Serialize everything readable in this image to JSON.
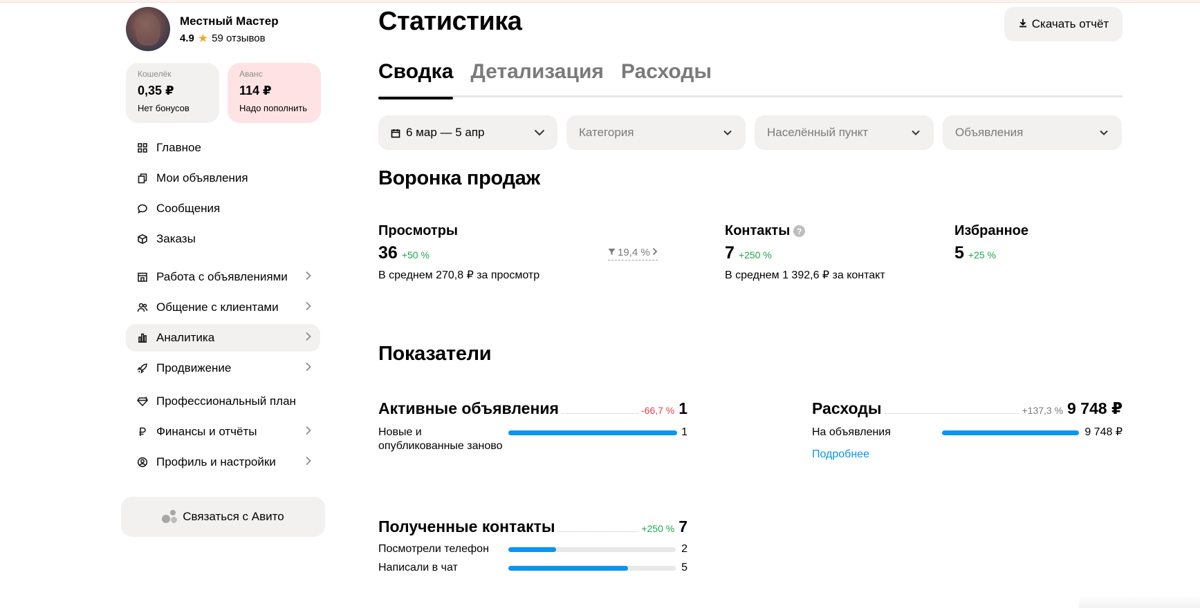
{
  "profile": {
    "name": "Местный Мастер",
    "rating": "4.9",
    "reviews": "59 отзывов"
  },
  "wallet": {
    "label": "Кошелёк",
    "value": "0,35 ₽",
    "sub": "Нет бонусов"
  },
  "advance": {
    "label": "Аванс",
    "value": "114 ₽",
    "sub": "Надо пополнить"
  },
  "nav": {
    "items": [
      {
        "label": "Главное",
        "icon": "grid-icon"
      },
      {
        "label": "Мои объявления",
        "icon": "copy-icon"
      },
      {
        "label": "Сообщения",
        "icon": "chat-bubble-icon"
      },
      {
        "label": "Заказы",
        "icon": "box-icon"
      },
      {
        "label": "Работа с объявлениями",
        "icon": "store-icon"
      },
      {
        "label": "Общение с клиентами",
        "icon": "people-icon"
      },
      {
        "label": "Аналитика",
        "icon": "bar-chart-icon",
        "active": true
      },
      {
        "label": "Продвижение",
        "icon": "rocket-icon"
      },
      {
        "label": "Профессиональный план",
        "icon": "diamond-icon"
      },
      {
        "label": "Финансы и отчёты",
        "icon": "ruble-icon"
      },
      {
        "label": "Профиль и настройки",
        "icon": "user-circle-icon"
      }
    ],
    "contact_button": "Связаться с Авито"
  },
  "header": {
    "title": "Статистика",
    "download_label": "Скачать отчёт"
  },
  "tabs": [
    {
      "label": "Сводка",
      "active": true
    },
    {
      "label": "Детализация"
    },
    {
      "label": "Расходы"
    }
  ],
  "filters": {
    "date": "6 мар — 5 апр",
    "category": "Категория",
    "location": "Населённый пункт",
    "ads": "Объявления"
  },
  "funnel": {
    "title": "Воронка продаж",
    "views": {
      "title": "Просмотры",
      "value": "36",
      "delta": "+50 %",
      "sub": "В среднем 270,8 ₽ за просмотр",
      "conversion": "19,4 %"
    },
    "contacts": {
      "title": "Контакты",
      "value": "7",
      "delta": "+250 %",
      "sub": "В среднем 1 392,6 ₽ за контакт"
    },
    "favorites": {
      "title": "Избранное",
      "value": "5",
      "delta": "+25 %"
    }
  },
  "indicators": {
    "title": "Показатели",
    "active_ads": {
      "title": "Активные объявления",
      "delta": "-66,7 %",
      "value": "1",
      "rows": [
        {
          "label": "Новые и опубликованные заново",
          "value": "1",
          "fraction": 1.0
        }
      ]
    },
    "expenses": {
      "title": "Расходы",
      "delta": "+137,3 %",
      "value": "9 748 ₽",
      "rows": [
        {
          "label": "На объявления",
          "value": "9 748 ₽",
          "fraction": 1.0
        }
      ],
      "more_link": "Подробнее"
    },
    "contacts_received": {
      "title": "Полученные контакты",
      "delta": "+250 %",
      "value": "7",
      "rows": [
        {
          "label": "Посмотрели телефон",
          "value": "2",
          "fraction": 0.2857
        },
        {
          "label": "Написали в чат",
          "value": "5",
          "fraction": 0.7143
        }
      ]
    }
  },
  "colors": {
    "accent_blue": "#0a95ef",
    "positive": "#1aa84a",
    "negative": "#e2424b",
    "advance_bg": "#ffe3e4",
    "surface": "#f2f1f0"
  }
}
